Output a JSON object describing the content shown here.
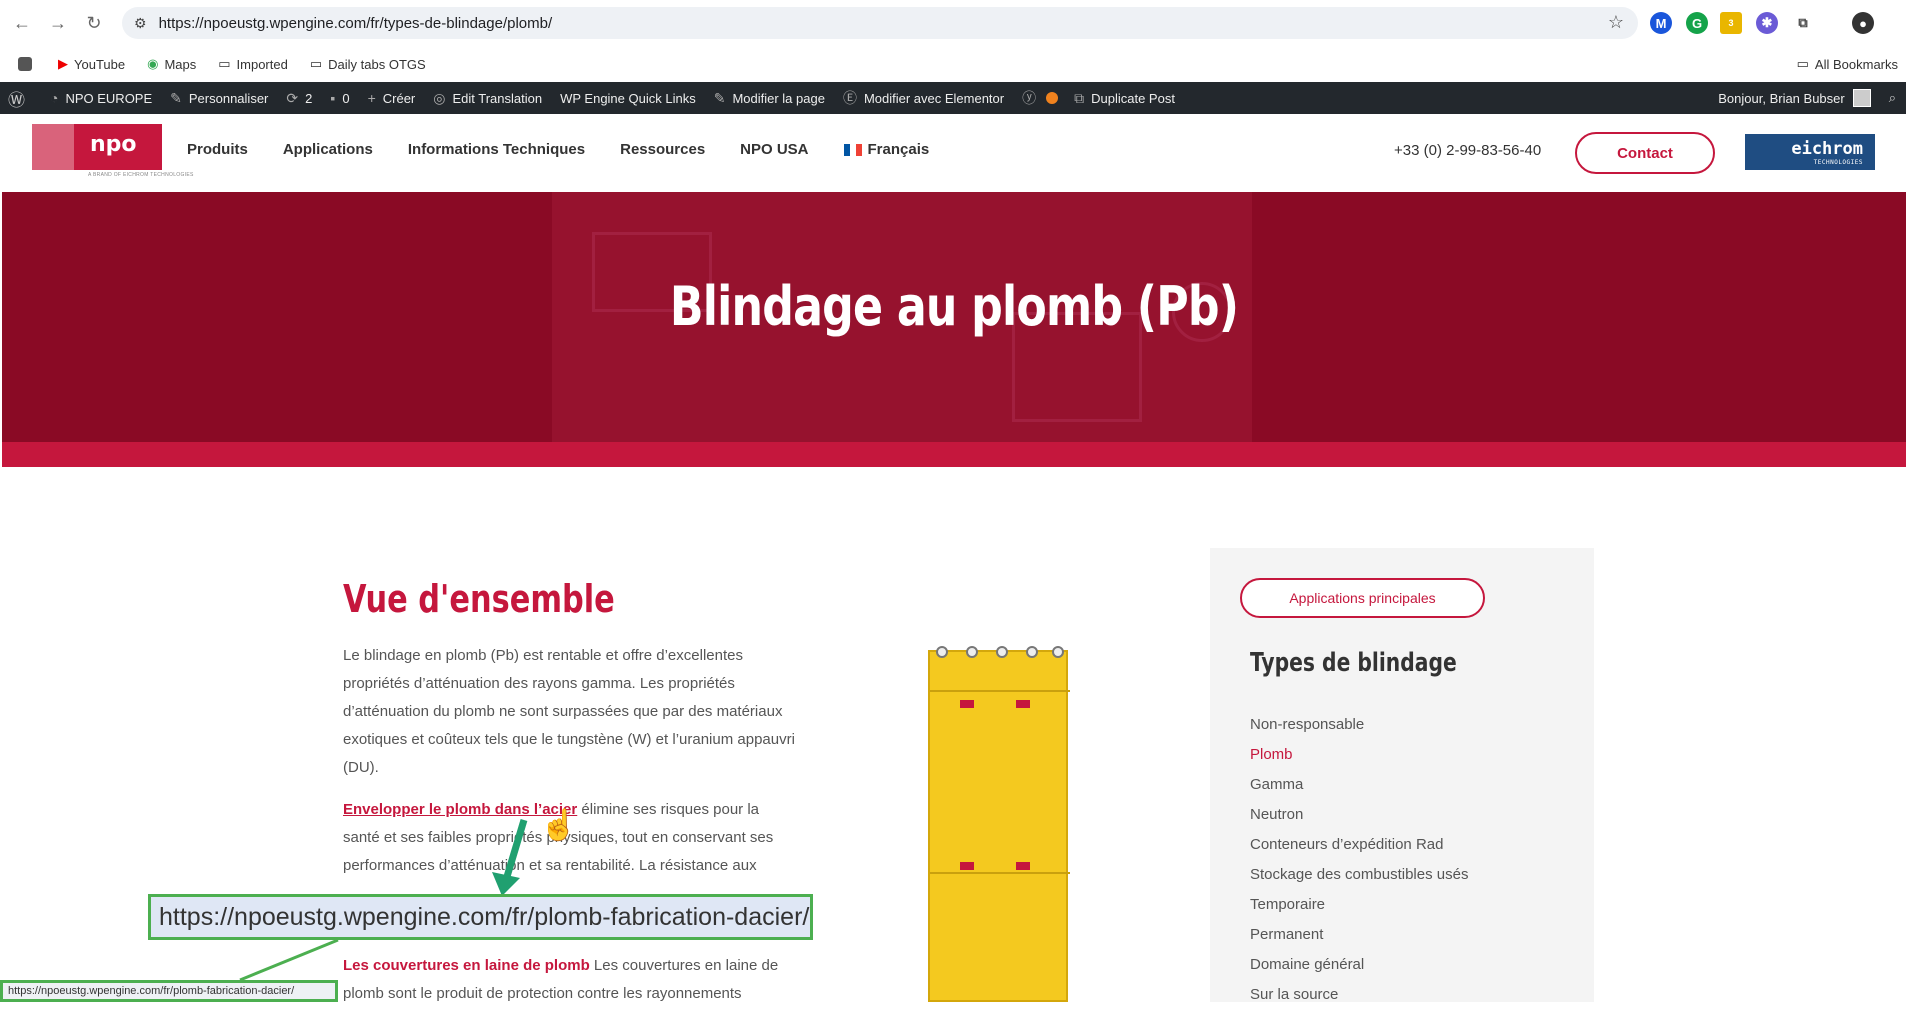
{
  "browser": {
    "url": "https://npoeustg.wpengine.com/fr/types-de-blindage/plomb/",
    "bookmarks": [
      "YouTube",
      "Maps",
      "Imported",
      "Daily tabs OTGS"
    ],
    "all_bookmarks": "All Bookmarks",
    "extension_badge": "3"
  },
  "adminbar": {
    "site": "NPO EUROPE",
    "customize": "Personnaliser",
    "updates": "2",
    "comments": "0",
    "new": "Créer",
    "edit_translation": "Edit Translation",
    "wpengine": "WP Engine Quick Links",
    "edit_page": "Modifier la page",
    "elementor": "Modifier avec Elementor",
    "duplicate": "Duplicate Post",
    "greeting": "Bonjour, Brian Bubser"
  },
  "header": {
    "logo_text": "npo",
    "logo_sub": "A BRAND OF EICHROM TECHNOLOGIES",
    "menu": [
      "Produits",
      "Applications",
      "Informations Techniques",
      "Ressources",
      "NPO USA",
      "Français"
    ],
    "phone": "+33 (0) 2-99-83-56-40",
    "contact": "Contact",
    "eichrom": "eichrom",
    "eichrom_sub": "TECHNOLOGIES"
  },
  "hero": {
    "title": "Blindage au plomb (Pb)"
  },
  "content": {
    "heading": "Vue d'ensemble",
    "p1": "Le blindage en plomb (Pb) est rentable et offre d’excellentes propriétés d’atténuation des rayons gamma. Les propriétés d’atténuation du plomb ne sont surpassées que par des matériaux exotiques et coûteux tels que le tungstène (W) et l’uranium appauvri (DU).",
    "p2_link": "Envelopper le plomb dans l’acier",
    "p2_text": " élimine ses risques pour la santé et ses faibles propriétés physiques, tout en conservant ses performances d’atténuation et sa rentabilité. La résistance aux",
    "p3_link": "Les couvertures en laine de plomb",
    "p3_text": " Les couvertures en laine de plomb sont le produit de protection contre les rayonnements"
  },
  "sidebar": {
    "button": "Applications principales",
    "heading": "Types de blindage",
    "items": [
      "Non-responsable",
      "Plomb",
      "Gamma",
      "Neutron",
      "Conteneurs d’expédition Rad",
      "Stockage des combustibles usés",
      "Temporaire",
      "Permanent",
      "Domaine général",
      "Sur la source"
    ],
    "active_index": 1
  },
  "annotation": {
    "callout_url": "https://npoeustg.wpengine.com/fr/plomb-fabrication-dacier/",
    "status_url": "https://npoeustg.wpengine.com/fr/plomb-fabrication-dacier/"
  },
  "colors": {
    "brand": "#c5173d",
    "hero": "#8a0a25",
    "adminbar": "#23282d",
    "highlight": "#4caf50"
  }
}
